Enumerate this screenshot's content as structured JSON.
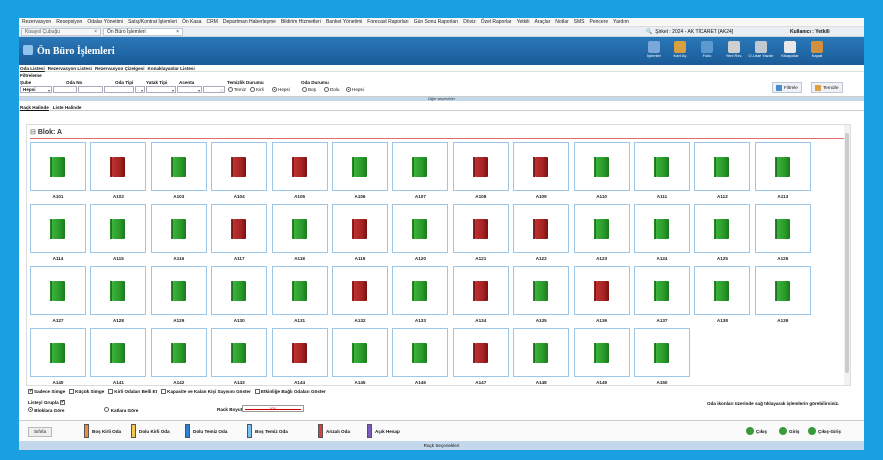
{
  "menu": [
    "Rezervasyon",
    "Resepsiyon",
    "Odalar Yönetimi",
    "Satış/Kontrat İşlemleri",
    "Ön Kasa",
    "CRM",
    "Departman Haberleşme",
    "Bildirim Hizmetleri",
    "Banket Yönetimi",
    "Forecast Raporları",
    "Gün Sonu Raporları",
    "Döviz",
    "Özel Raporlar",
    "Yetkili",
    "Araçlar",
    "Notlar",
    "SMS",
    "Pencere",
    "Yardım"
  ],
  "tabs": [
    {
      "label": "Kisayol Çubuğu"
    },
    {
      "label": "Ön Büro İşlemleri"
    }
  ],
  "company": "Şirket : 2024 - AK TİCARET [AK24]",
  "user": "Kullanıcı : Yetkili",
  "header": {
    "title": "Ön Büro İşlemleri",
    "buttons": [
      "İşlemler",
      "Kart Aç",
      "Folio",
      "Yeni Rzv.",
      "O.Liste Yazdır",
      "Kisayollar",
      "Kapat"
    ]
  },
  "subtabs": [
    "Oda Listesi",
    "Rezervasyon Listesi",
    "Rezervasyon Çizelgesi",
    "Konaklayanlar Listesi"
  ],
  "filters": {
    "heading": "Filtreleme",
    "sube_label": "Şube",
    "sube_value": "Hepsi",
    "oda_no_label": "Oda No",
    "oda_tipi_label": "Oda Tipi",
    "yatak_tipi_label": "Yatak Tipi",
    "acenta_label": "Acenta",
    "temizlik_label": "Temizlik Durumu",
    "temizlik_options": [
      "Temiz",
      "Kirli",
      "Hepsi"
    ],
    "temizlik_selected": "Hepsi",
    "oda_durumu_label": "Oda Durumu",
    "oda_durumu_options": [
      "Boş",
      "Dolu",
      "Hepsi"
    ],
    "oda_durumu_selected": "Hepsi",
    "filtrele": "Filtrele",
    "temizle": "Temizle",
    "diger": "Diğer seçenekler"
  },
  "view_tabs": [
    "Raçk Halinde",
    "Liste Halinde"
  ],
  "blok": "Blok: A",
  "rooms": [
    {
      "no": "A101",
      "status": "green"
    },
    {
      "no": "A102",
      "status": "red"
    },
    {
      "no": "A103",
      "status": "green"
    },
    {
      "no": "A104",
      "status": "red"
    },
    {
      "no": "A105",
      "status": "red"
    },
    {
      "no": "A106",
      "status": "green"
    },
    {
      "no": "A107",
      "status": "green"
    },
    {
      "no": "A108",
      "status": "red"
    },
    {
      "no": "A109",
      "status": "red"
    },
    {
      "no": "A110",
      "status": "green"
    },
    {
      "no": "A111",
      "status": "green"
    },
    {
      "no": "A112",
      "status": "green"
    },
    {
      "no": "A113",
      "status": "green"
    },
    {
      "no": "A114",
      "status": "green"
    },
    {
      "no": "A115",
      "status": "green"
    },
    {
      "no": "A116",
      "status": "green"
    },
    {
      "no": "A117",
      "status": "red"
    },
    {
      "no": "A118",
      "status": "green"
    },
    {
      "no": "A119",
      "status": "red"
    },
    {
      "no": "A120",
      "status": "green"
    },
    {
      "no": "A121",
      "status": "red"
    },
    {
      "no": "A122",
      "status": "red"
    },
    {
      "no": "A123",
      "status": "green"
    },
    {
      "no": "A124",
      "status": "green"
    },
    {
      "no": "A125",
      "status": "green"
    },
    {
      "no": "A126",
      "status": "green"
    },
    {
      "no": "A127",
      "status": "green"
    },
    {
      "no": "A128",
      "status": "green"
    },
    {
      "no": "A129",
      "status": "green"
    },
    {
      "no": "A130",
      "status": "green"
    },
    {
      "no": "A131",
      "status": "green"
    },
    {
      "no": "A132",
      "status": "red"
    },
    {
      "no": "A133",
      "status": "green"
    },
    {
      "no": "A134",
      "status": "red"
    },
    {
      "no": "A135",
      "status": "green"
    },
    {
      "no": "A136",
      "status": "red"
    },
    {
      "no": "A137",
      "status": "green"
    },
    {
      "no": "A138",
      "status": "green"
    },
    {
      "no": "A139",
      "status": "green"
    },
    {
      "no": "A140",
      "status": "green"
    },
    {
      "no": "A141",
      "status": "green"
    },
    {
      "no": "A142",
      "status": "green"
    },
    {
      "no": "A143",
      "status": "green"
    },
    {
      "no": "A144",
      "status": "red"
    },
    {
      "no": "A145",
      "status": "green"
    },
    {
      "no": "A146",
      "status": "green"
    },
    {
      "no": "A147",
      "status": "red"
    },
    {
      "no": "A148",
      "status": "green"
    },
    {
      "no": "A149",
      "status": "green"
    },
    {
      "no": "A150",
      "status": "green"
    }
  ],
  "options": [
    {
      "label": "Sadece Simge",
      "checked": true
    },
    {
      "label": "Küçük Simge",
      "checked": false
    },
    {
      "label": "Kirli Odaları Belli Et",
      "checked": false
    },
    {
      "label": "Kapasite ve Kalan Kişi Sayısını Göster",
      "checked": false
    },
    {
      "label": "Etkinliğe Bağlı Odaları Göster",
      "checked": false
    }
  ],
  "hint": "Oda ikonları üzerinde sağ tıklayarak işlemlerin görebilirsiniz.",
  "grouping": {
    "label": "Listeyi Grupla",
    "blok": "Bloklara Göre",
    "kat": "Katlara Göre"
  },
  "rack_size": {
    "label": "Rack Boyutu",
    "value": "105"
  },
  "legend": [
    {
      "label": "Boş Kirli Oda",
      "color": "#e8913a"
    },
    {
      "label": "Dolu Kirli Oda",
      "color": "#f2c84a"
    },
    {
      "label": "Dolu Temiz Oda",
      "color": "#2e7fd6"
    },
    {
      "label": "Boş Temiz Oda",
      "color": "#7cc0f0"
    },
    {
      "label": "Arızalı Oda",
      "color": "#d84040"
    },
    {
      "label": "Açık Hesap",
      "color": "#7a5cc0"
    }
  ],
  "sifirla": "Sıfırla",
  "actions": [
    "Çıkış",
    "Giriş",
    "Çıkış-Giriş"
  ],
  "footer": "Raçk Seçenekleri",
  "colors": {
    "green": "#2a9a2a",
    "red": "#a52424",
    "header": "#1f6aab",
    "bg": "#1a9fe0"
  }
}
